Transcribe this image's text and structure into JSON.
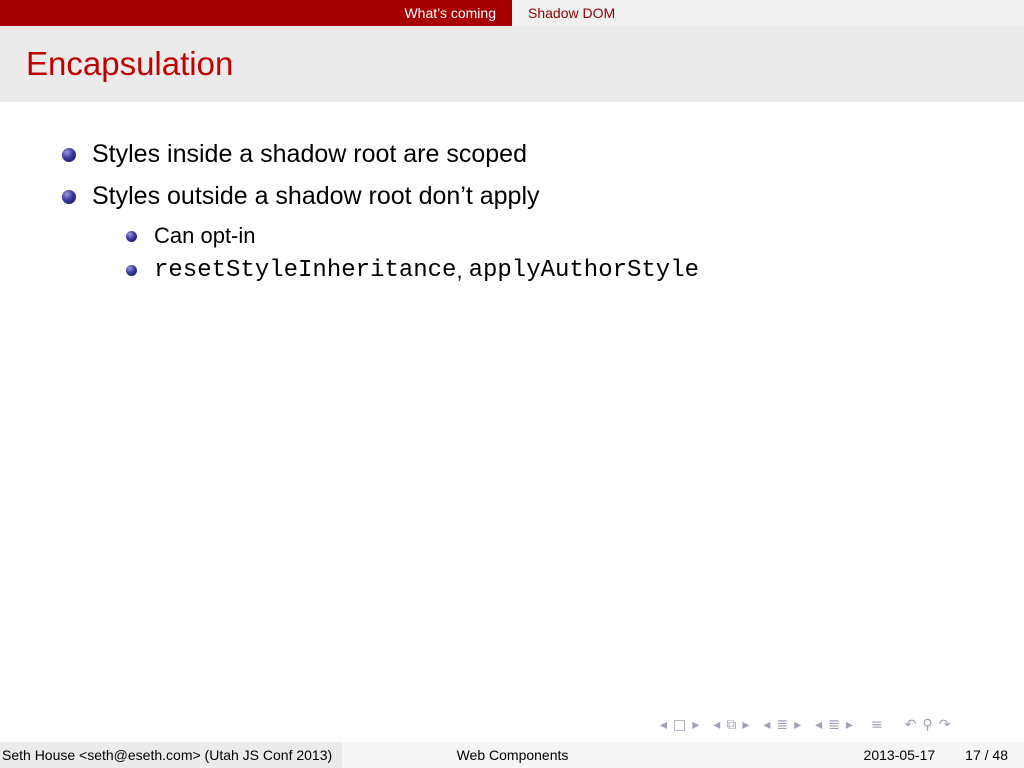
{
  "nav": {
    "sections": [
      {
        "label": "What’s coming"
      },
      {
        "label": "Shadow DOM"
      }
    ]
  },
  "frame": {
    "title": "Encapsulation"
  },
  "bullets": [
    {
      "text": "Styles inside a shadow root are scoped"
    },
    {
      "text": "Styles outside a shadow root don’t apply"
    }
  ],
  "subbullets": [
    {
      "text": "Can opt-in"
    },
    {
      "code1": "resetStyleInheritance",
      "sep": ",",
      "code2": "applyAuthorStyle"
    }
  ],
  "footer": {
    "author": "Seth House <seth@eseth.com>  (Utah JS Conf 2013)",
    "title": "Web Components",
    "date": "2013-05-17",
    "page": "17 / 48"
  },
  "colors": {
    "accent_red": "#a80000",
    "title_red": "#c00000",
    "bullet_blue": "#3a3aa0"
  },
  "nav_icons": [
    "nav-prev-icon",
    "frame-icon",
    "nav-next-icon",
    "nav-prev-icon",
    "subsection-icon",
    "nav-next-icon",
    "nav-prev-icon",
    "section-icon",
    "nav-next-icon",
    "nav-prev-icon",
    "document-icon",
    "nav-next-icon",
    "toc-icon",
    "back-icon",
    "search-icon",
    "forward-icon"
  ]
}
